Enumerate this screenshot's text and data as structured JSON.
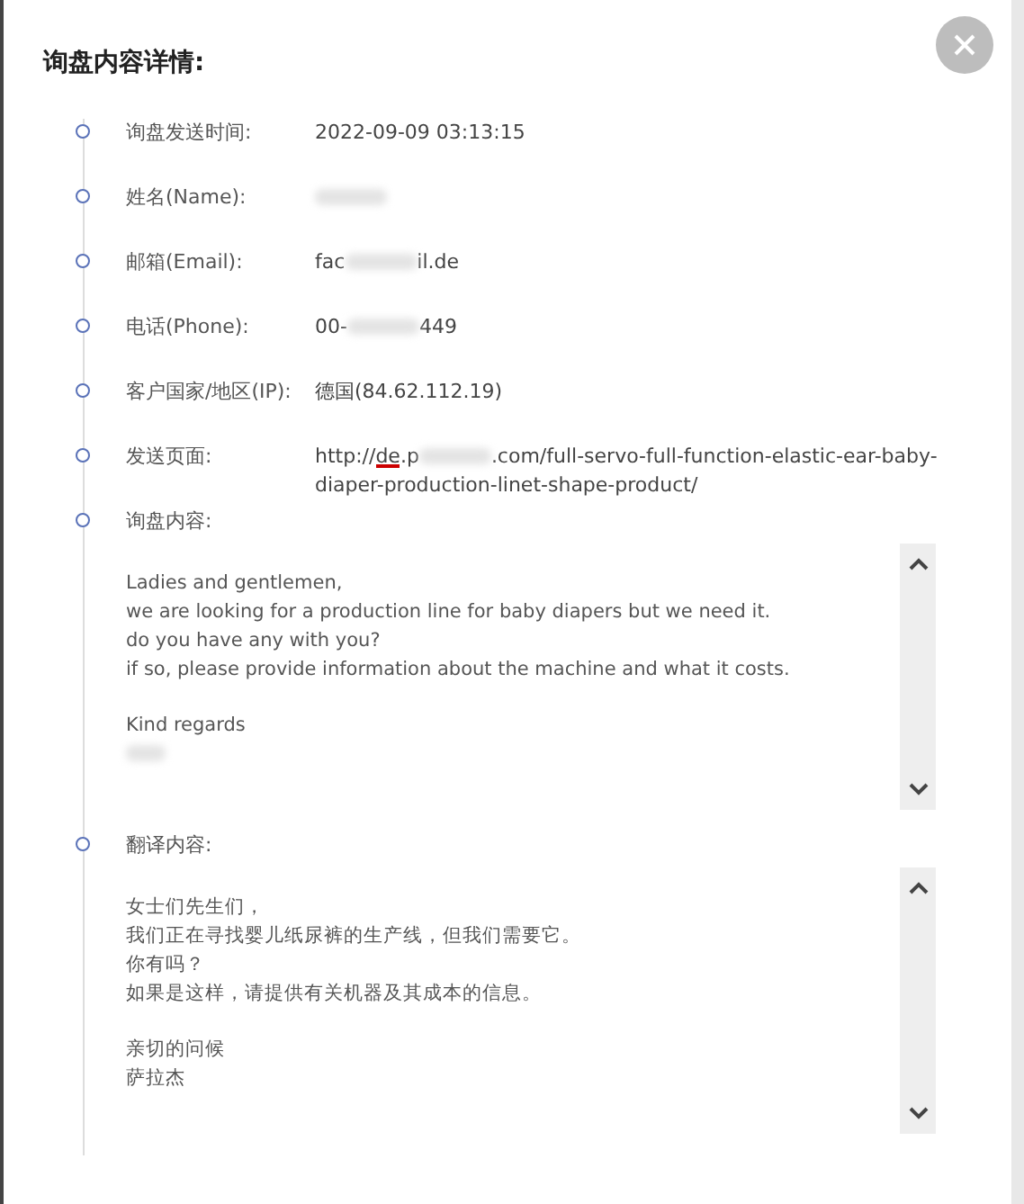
{
  "dialog": {
    "title": "询盘内容详情:"
  },
  "items": [
    {
      "kind": "field",
      "label": "询盘发送时间:",
      "value": [
        {
          "text": "2022-09-09 03:13:15"
        }
      ]
    },
    {
      "kind": "field",
      "label": "姓名(Name):",
      "value": [
        {
          "redacted": true
        }
      ]
    },
    {
      "kind": "field",
      "label": "邮箱(Email):",
      "value": [
        {
          "text": "fac"
        },
        {
          "redacted": true
        },
        {
          "text": "il.de"
        }
      ]
    },
    {
      "kind": "field",
      "label": "电话(Phone):",
      "value": [
        {
          "text": "00-"
        },
        {
          "redacted": true
        },
        {
          "text": "449"
        }
      ]
    },
    {
      "kind": "field",
      "label": "客户国家/地区(IP):",
      "value": [
        {
          "text": "德国(84.62.112.19)"
        }
      ]
    },
    {
      "kind": "field",
      "label": "发送页面:",
      "value": [
        {
          "text": "http://"
        },
        {
          "text": "de",
          "flagged": true
        },
        {
          "text": ".p"
        },
        {
          "redacted": true
        },
        {
          "text": ".com/full-servo-full-function-elastic-ear-baby-diaper-production-linet-shape-product/"
        }
      ]
    },
    {
      "kind": "textbox",
      "label": "询盘内容:",
      "paragraphs": [
        [
          "Ladies and gentlemen,",
          "we are looking for a production line for baby diapers but we need it.",
          "do you have any with you?",
          "if so, please provide information about the machine and what it costs."
        ],
        [
          "Kind regards"
        ]
      ],
      "signature_redacted": true
    },
    {
      "kind": "textbox",
      "label": "翻译内容:",
      "paragraphs": [
        [
          "女士们先生们，",
          "我们正在寻找婴儿纸尿裤的生产线，但我们需要它。",
          "你有吗？",
          "如果是这样，请提供有关机器及其成本的信息。"
        ],
        [
          "亲切的问候",
          "萨拉杰"
        ]
      ],
      "signature_redacted": false
    }
  ]
}
